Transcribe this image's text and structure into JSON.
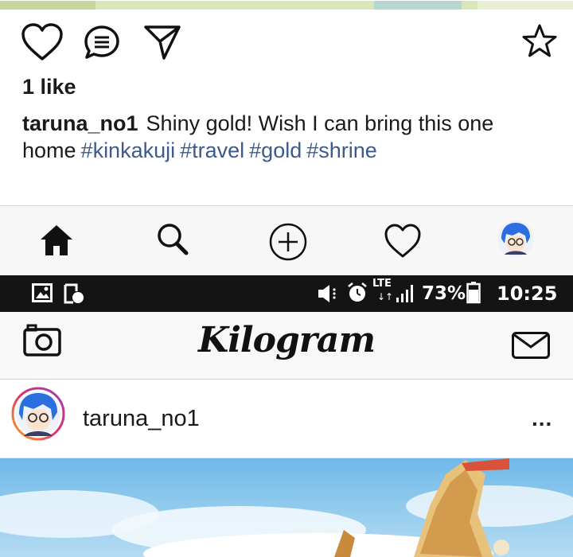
{
  "post": {
    "likes_text": "1 like",
    "caption_user": "taruna_no1",
    "caption_text": "Shiny gold! Wish I can bring this one home",
    "hashtags": [
      "#kinkakuji",
      "#travel",
      "#gold",
      "#shrine"
    ]
  },
  "icons": {
    "like": "heart-icon",
    "comment": "comment-icon",
    "share": "send-icon",
    "save": "star-icon",
    "nav": [
      "home-icon",
      "search-icon",
      "add-icon",
      "activity-heart-icon",
      "profile-avatar"
    ],
    "camera": "camera-icon",
    "messages": "envelope-icon",
    "more": "more-dots-icon"
  },
  "status_bar": {
    "battery": "73%",
    "time": "10:25",
    "network": "LTE"
  },
  "app": {
    "title": "Kilogram"
  },
  "post_header": {
    "username": "taruna_no1",
    "more": "..."
  },
  "colors": {
    "hashtag": "#3d5a8f",
    "status_bar_bg": "#141414",
    "avatar_hair": "#2b6ee0",
    "sky": "#8ec9ee"
  }
}
